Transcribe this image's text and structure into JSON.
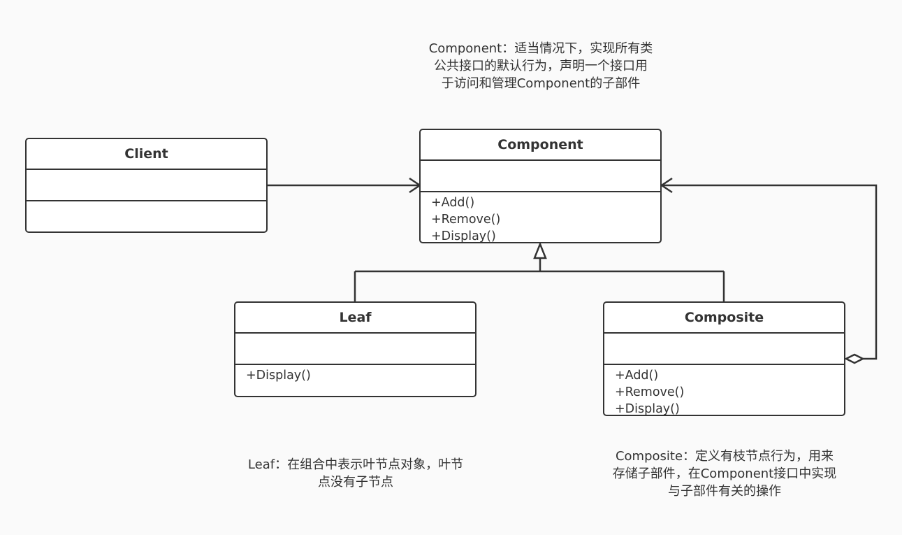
{
  "classes": {
    "client": {
      "name": "Client",
      "methods": []
    },
    "component": {
      "name": "Component",
      "methods": [
        "+Add()",
        "+Remove()",
        "+Display()"
      ]
    },
    "leaf": {
      "name": "Leaf",
      "methods": [
        "+Display()"
      ]
    },
    "composite": {
      "name": "Composite",
      "methods": [
        "+Add()",
        "+Remove()",
        "+Display()"
      ]
    }
  },
  "notes": {
    "component": [
      "Component：适当情况下，实现所有类",
      "公共接口的默认行为，声明一个接口用",
      "于访问和管理Component的子部件"
    ],
    "leaf": [
      "Leaf：在组合中表示叶节点对象，叶节",
      "点没有子节点"
    ],
    "composite": [
      "Composite：定义有枝节点行为，用来",
      "存储子部件，在Component接口中实现",
      "与子部件有关的操作"
    ]
  },
  "colors": {
    "background": "#fafafa",
    "stroke": "#333333",
    "box_fill": "#ffffff"
  }
}
